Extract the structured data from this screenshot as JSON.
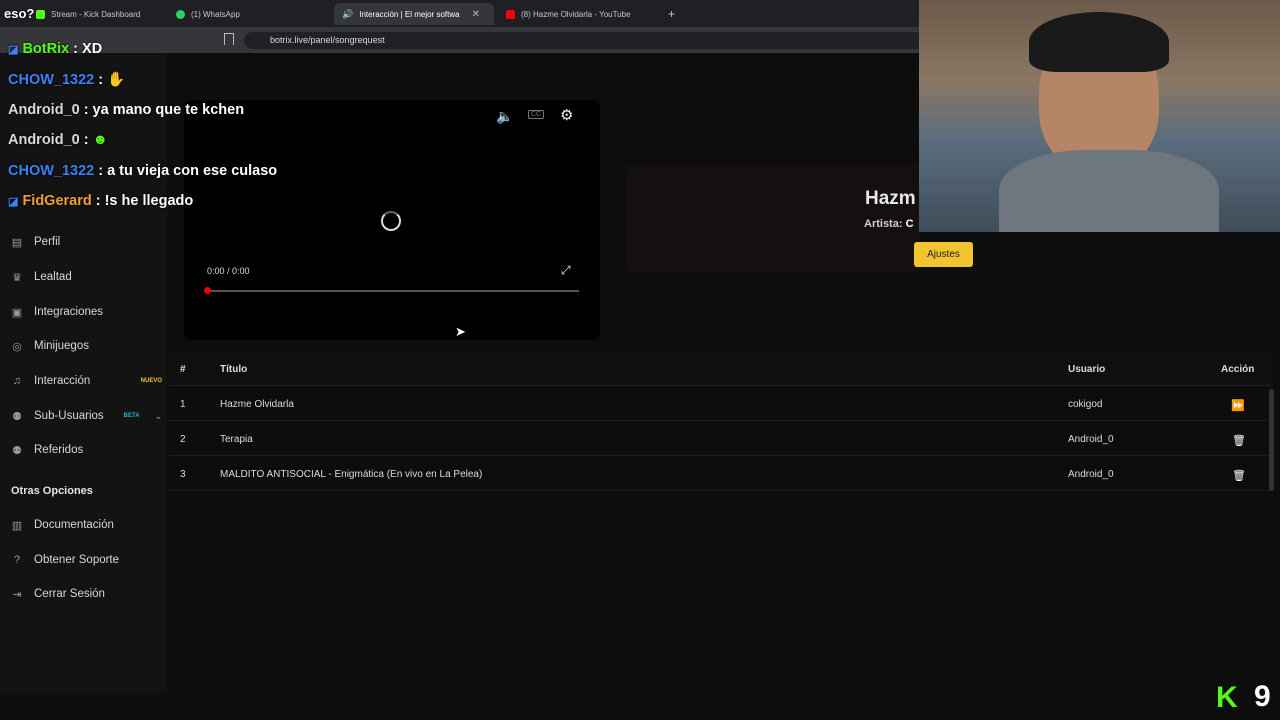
{
  "browser": {
    "tabs": [
      {
        "label": "Stream - Kick Dashboard",
        "active": false
      },
      {
        "label": "(1) WhatsApp",
        "active": false
      },
      {
        "label": "Interacción | El mejor softwa",
        "active": true
      },
      {
        "label": "(8) Hazme Olvidarla - YouTube",
        "active": false
      }
    ],
    "url": "botrix.live/panel/songrequest"
  },
  "sidebar": {
    "items": [
      {
        "label": "Perfil",
        "icon": "id-card-icon"
      },
      {
        "label": "Lealtad",
        "icon": "trophy-icon"
      },
      {
        "label": "Integraciones",
        "icon": "chip-icon"
      },
      {
        "label": "Minijuegos",
        "icon": "gamepad-icon"
      },
      {
        "label": "Interacción",
        "icon": "music-icon",
        "badge": "NUEVO"
      },
      {
        "label": "Sub-Usuarios",
        "icon": "users-icon",
        "badge": "BETA"
      },
      {
        "label": "Referidos",
        "icon": "users-icon"
      }
    ],
    "section_title": "Otras Opciones",
    "other_items": [
      {
        "label": "Documentación",
        "icon": "book-icon"
      },
      {
        "label": "Obtener Soporte",
        "icon": "help-icon"
      },
      {
        "label": "Cerrar Sesión",
        "icon": "logout-icon"
      }
    ]
  },
  "player": {
    "time": "0:00 / 0:00"
  },
  "now_playing": {
    "title": "Hazm",
    "artist_label": "Artista:",
    "artist_value": "C",
    "settings_button": "Ajustes"
  },
  "queue": {
    "headers": [
      "#",
      "Título",
      "Usuario",
      "Acción"
    ],
    "rows": [
      {
        "n": "1",
        "title": "Hazme Olvidarla",
        "user": "cokigod",
        "action": "play"
      },
      {
        "n": "2",
        "title": "Terapia",
        "user": "Android_0",
        "action": "delete"
      },
      {
        "n": "3",
        "title": "MALDITO ANTISOCIAL - Enigmática (En vivo en La Pelea)",
        "user": "Android_0",
        "action": "delete"
      }
    ]
  },
  "chat": {
    "top_line": "eso?",
    "messages": [
      {
        "user": "BotRix",
        "text": ": XD",
        "color": "#53fc18"
      },
      {
        "user": "CHOW_1322",
        "text": ":",
        "color": "#3b82f6"
      },
      {
        "user": "Android_0",
        "text": ": ya mano que te kchen",
        "color": "#d9d9d9"
      },
      {
        "user": "Android_0",
        "text": ":",
        "color": "#d9d9d9"
      },
      {
        "user": "CHOW_1322",
        "text": ": a tu vieja con ese culaso",
        "color": "#3b82f6"
      },
      {
        "user": "FidGerard",
        "text": ": !s he llegado",
        "color": "#f0a030"
      }
    ]
  },
  "stream_overlay": {
    "kick_logo": "K",
    "viewer_count": "9"
  },
  "colors": {
    "accent": "#f2c430",
    "kick_green": "#53fc18",
    "beta": "#22b8cf",
    "nuevo": "#f2c430"
  }
}
